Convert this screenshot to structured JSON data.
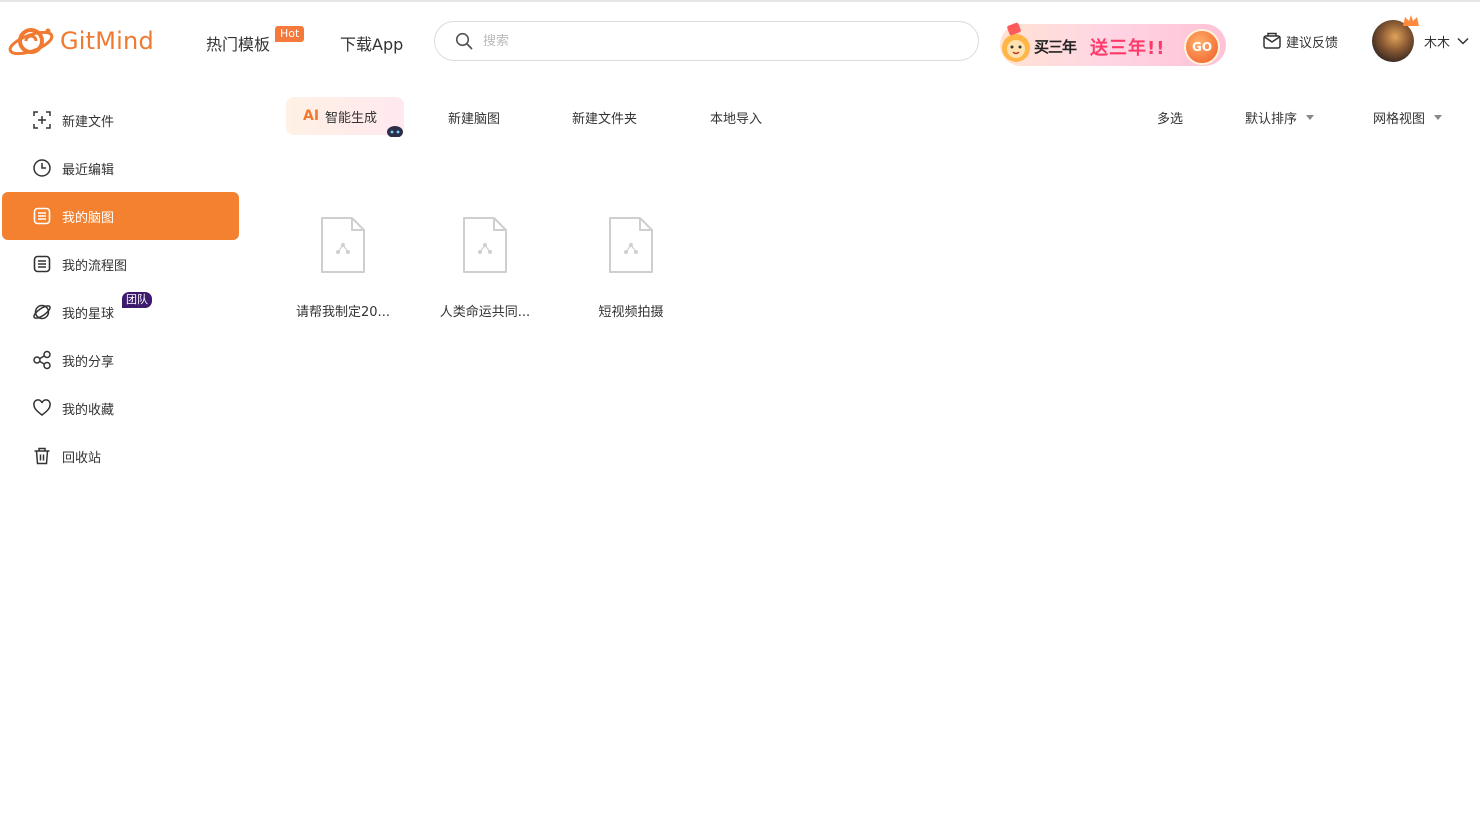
{
  "header": {
    "logo_text": "GitMind",
    "nav": {
      "templates": "热门模板",
      "hot_badge": "Hot",
      "download_app": "下载App"
    },
    "search": {
      "placeholder": "搜索"
    },
    "promo": {
      "text_a": "买三年",
      "text_b": "送三年!!",
      "go": "GO"
    },
    "feedback": "建议反馈",
    "user": {
      "name": "木木"
    }
  },
  "sidebar": {
    "items": [
      {
        "label": "新建文件",
        "icon": "new-file-icon"
      },
      {
        "label": "最近编辑",
        "icon": "clock-icon"
      },
      {
        "label": "我的脑图",
        "icon": "mindmap-doc-icon",
        "active": true
      },
      {
        "label": "我的流程图",
        "icon": "flowchart-doc-icon"
      },
      {
        "label": "我的星球",
        "icon": "planet-icon",
        "badge": "团队"
      },
      {
        "label": "我的分享",
        "icon": "share-icon"
      },
      {
        "label": "我的收藏",
        "icon": "heart-icon"
      },
      {
        "label": "回收站",
        "icon": "trash-icon"
      }
    ]
  },
  "toolbar": {
    "ai_mark": "AI",
    "ai_generate": "智能生成",
    "new_mindmap": "新建脑图",
    "new_folder": "新建文件夹",
    "local_import": "本地导入",
    "multi_select": "多选",
    "sort": "默认排序",
    "view": "网格视图"
  },
  "files": [
    {
      "name": "请帮我制定20..."
    },
    {
      "name": "人类命运共同..."
    },
    {
      "name": "短视频拍摄"
    }
  ],
  "colors": {
    "accent": "#f4812f",
    "brand": "#f07a32",
    "team_badge": "#3d1a6e",
    "promo_pink": "#ff3a6a"
  }
}
